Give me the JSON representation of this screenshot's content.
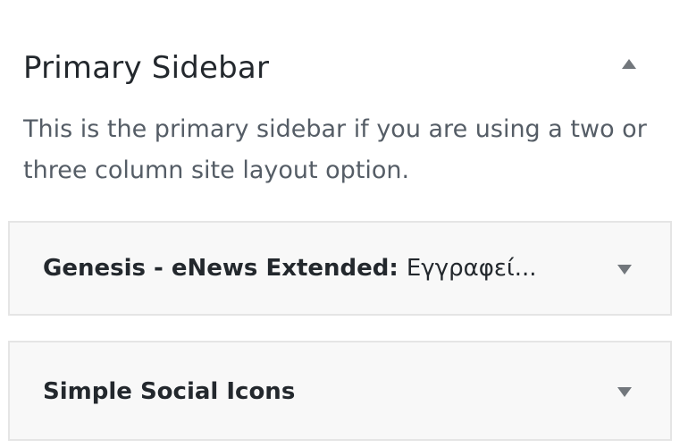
{
  "sidebar": {
    "title": "Primary Sidebar",
    "description": "This is the primary sidebar if you are using a two or three column site layout option.",
    "toggle_icon": "arrow-up-icon"
  },
  "widgets": [
    {
      "name": "Genesis - eNews Extended:",
      "in_title": "Εγγραφεί...",
      "toggle_icon": "arrow-down-icon"
    },
    {
      "name": "Simple Social Icons",
      "in_title": "",
      "toggle_icon": "arrow-down-icon"
    }
  ],
  "colors": {
    "text": "#23282d",
    "muted_text": "#555d66",
    "icon": "#72777c",
    "widget_bg": "#f8f8f8",
    "widget_border": "#e5e5e5"
  }
}
